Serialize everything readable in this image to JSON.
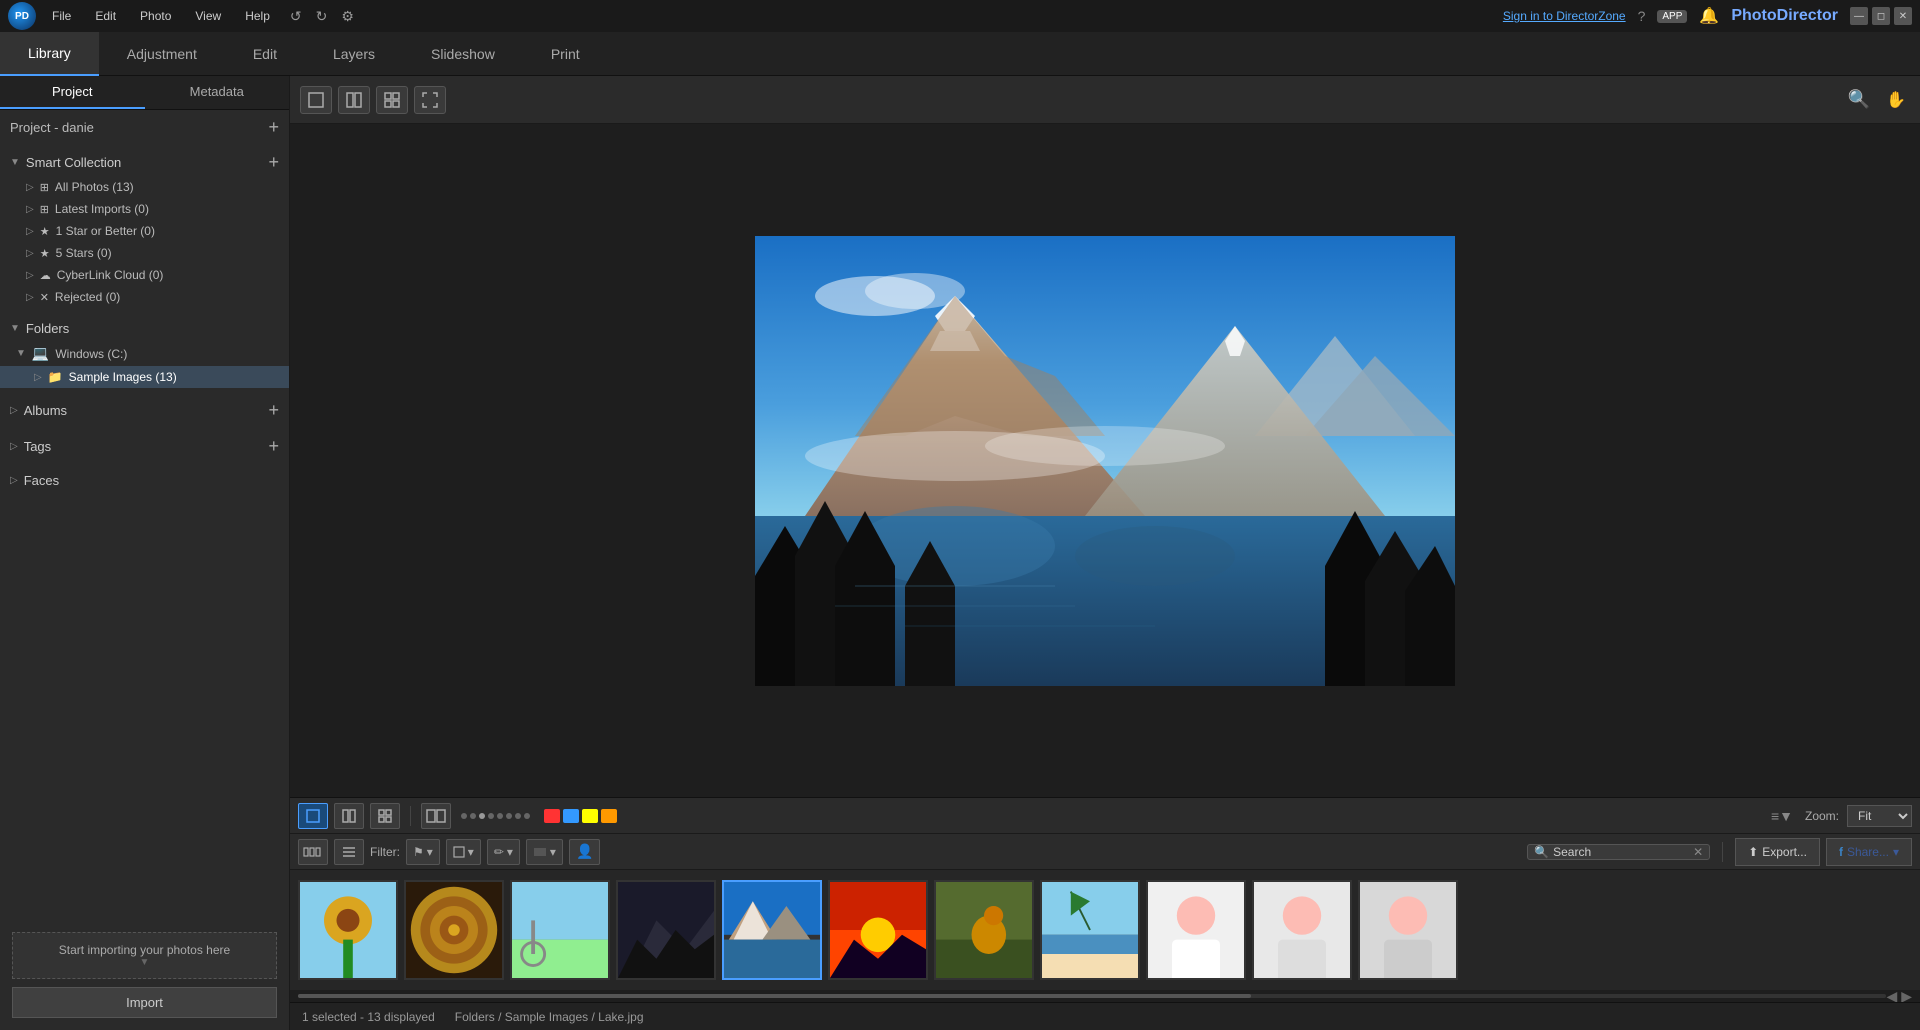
{
  "titlebar": {
    "logo_text": "PD",
    "menu_items": [
      "File",
      "Edit",
      "Photo",
      "View",
      "Help"
    ],
    "toolbar_undo": "↺",
    "toolbar_redo": "↻",
    "toolbar_settings": "⚙",
    "sign_in_text": "Sign in to DirectorZone",
    "app_badge": "APP",
    "app_title": "PhotoDirector",
    "win_minimize": "—",
    "win_restore": "◻",
    "win_close": "✕"
  },
  "nav_tabs": [
    {
      "label": "Library",
      "active": true
    },
    {
      "label": "Adjustment",
      "active": false
    },
    {
      "label": "Edit",
      "active": false
    },
    {
      "label": "Layers",
      "active": false
    },
    {
      "label": "Slideshow",
      "active": false
    },
    {
      "label": "Print",
      "active": false
    }
  ],
  "sidebar": {
    "project_label": "Project - danie",
    "tabs": [
      {
        "label": "Project",
        "active": true
      },
      {
        "label": "Metadata",
        "active": false
      }
    ],
    "smart_collection": {
      "label": "Smart Collection",
      "items": [
        {
          "label": "All Photos (13)",
          "icon": "⊞"
        },
        {
          "label": "Latest Imports (0)",
          "icon": "⊞"
        },
        {
          "label": "1 Star or Better (0)",
          "icon": "★"
        },
        {
          "label": "5 Stars (0)",
          "icon": "★"
        },
        {
          "label": "CyberLink Cloud (0)",
          "icon": "☁"
        },
        {
          "label": "Rejected (0)",
          "icon": "✕"
        }
      ]
    },
    "folders": {
      "label": "Folders",
      "items": [
        {
          "label": "Windows (C:)",
          "icon": "💻",
          "children": [
            {
              "label": "Sample Images (13)",
              "icon": "📁",
              "selected": true
            }
          ]
        }
      ]
    },
    "albums": {
      "label": "Albums"
    },
    "tags": {
      "label": "Tags"
    },
    "faces": {
      "label": "Faces"
    },
    "import_hint": "Start importing your photos here",
    "import_btn": "Import"
  },
  "view_toolbar": {
    "view_single": "▣",
    "view_compare": "⊞",
    "view_grid": "⊟",
    "view_fullscreen": "⛶",
    "search_icon": "🔍",
    "hand_icon": "✋"
  },
  "filmstrip_controls": {
    "view_single_active": true,
    "dots": [
      false,
      false,
      false,
      false,
      false,
      false,
      false,
      false
    ],
    "colors": [
      "#ff3333",
      "#3399ff",
      "#ffff00",
      "#ff9900"
    ],
    "zoom_label": "Zoom:",
    "zoom_value": "Fit",
    "sort_icon": "≡",
    "filter_label": "Filter:",
    "search_placeholder": "Search",
    "search_value": "Search",
    "export_label": "Export...",
    "share_label": "Share...",
    "fb_icon": "f"
  },
  "thumbnails": [
    {
      "id": 1,
      "color_top": "#87CEEB",
      "color_bottom": "#DAA520",
      "label": "sunflower"
    },
    {
      "id": 2,
      "color_top": "#8B4513",
      "color_bottom": "#DAA520",
      "label": "spiral"
    },
    {
      "id": 3,
      "color_top": "#90EE90",
      "color_bottom": "#90EE90",
      "label": "field"
    },
    {
      "id": 4,
      "color_top": "#2a2a2a",
      "color_bottom": "#333",
      "label": "dark"
    },
    {
      "id": 5,
      "color_top": "#4a90d9",
      "color_bottom": "#2a5a8a",
      "label": "lake",
      "selected": true
    },
    {
      "id": 6,
      "color_top": "#ff6633",
      "color_bottom": "#220022",
      "label": "sunset"
    },
    {
      "id": 7,
      "color_top": "#556b2f",
      "color_bottom": "#556b2f",
      "label": "grass"
    },
    {
      "id": 8,
      "color_top": "#87CEEB",
      "color_bottom": "#f5deb3",
      "label": "beach"
    },
    {
      "id": 9,
      "color_top": "#fff",
      "color_bottom": "#fff",
      "label": "portrait1"
    },
    {
      "id": 10,
      "color_top": "#fff",
      "color_bottom": "#fff",
      "label": "portrait2"
    },
    {
      "id": 11,
      "color_top": "#fff",
      "color_bottom": "#fff",
      "label": "portrait3"
    }
  ],
  "statusbar": {
    "selected_text": "1 selected - 13 displayed",
    "path_text": "Folders / Sample Images / Lake.jpg"
  }
}
